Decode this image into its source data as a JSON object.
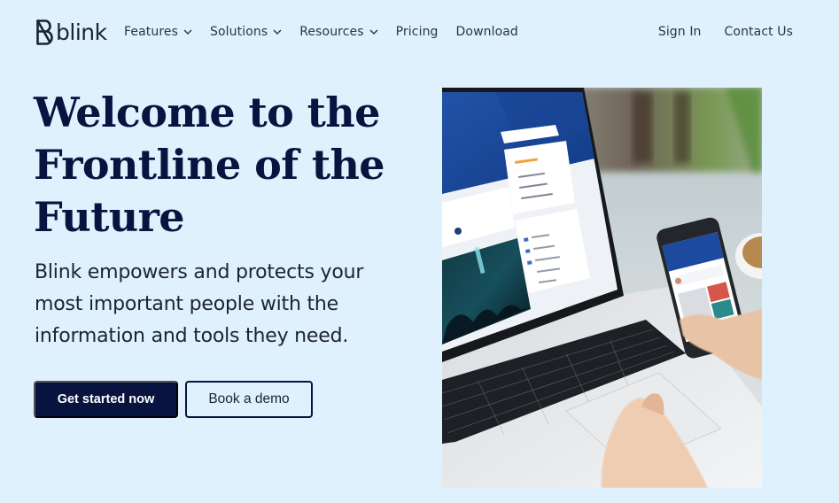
{
  "brand": {
    "name": "blink",
    "logo_icon": "blink-b-logo-icon"
  },
  "nav": {
    "items": [
      {
        "label": "Features",
        "has_dropdown": true
      },
      {
        "label": "Solutions",
        "has_dropdown": true
      },
      {
        "label": "Resources",
        "has_dropdown": true
      },
      {
        "label": "Pricing",
        "has_dropdown": false
      },
      {
        "label": "Download",
        "has_dropdown": false
      }
    ],
    "right_items": [
      {
        "label": "Sign In"
      },
      {
        "label": "Contact Us"
      }
    ],
    "dropdown_icon": "chevron-down-icon"
  },
  "hero": {
    "title_lines": [
      "Welcome to the",
      "Frontline of the",
      "Future"
    ],
    "subtitle_lines": [
      "Blink empowers and protects your",
      "most important people with the",
      "information and tools they need."
    ],
    "primary_cta": "Get started now",
    "secondary_cta": "Book a demo",
    "image_alt": "Laptop and smartphone showing the Blink app"
  },
  "colors": {
    "background": "#dff1fd",
    "navy": "#08143f",
    "text": "#1c2334",
    "app_blue": "#1d4a9e"
  }
}
